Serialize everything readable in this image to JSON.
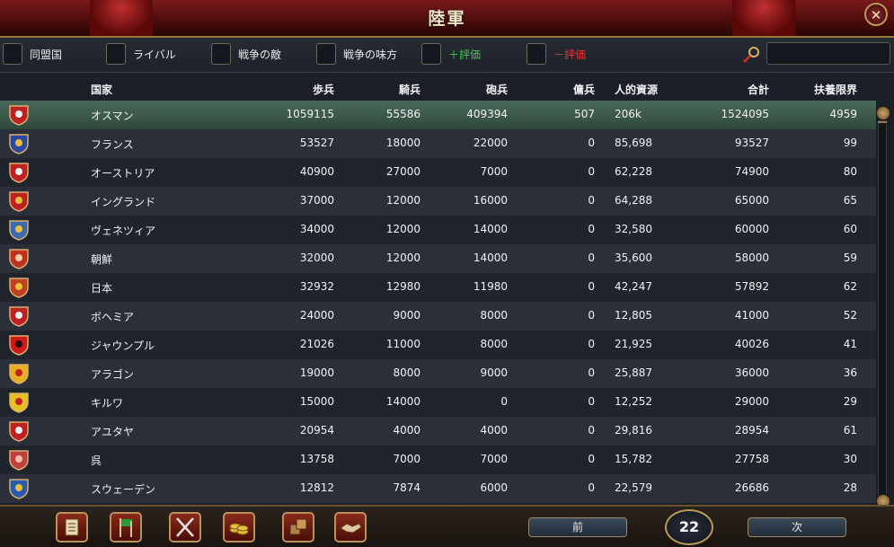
{
  "window": {
    "title": "陸軍",
    "close_label": "✕"
  },
  "filters": [
    {
      "label": "同盟国",
      "color": "#e8e8e8"
    },
    {
      "label": "ライバル",
      "color": "#e8e8e8"
    },
    {
      "label": "戦争の敵",
      "color": "#e8e8e8"
    },
    {
      "label": "戦争の味方",
      "color": "#e8e8e8"
    },
    {
      "label": "＋評価",
      "color": "#3ad04a"
    },
    {
      "label": "－評価",
      "color": "#e03a3a"
    }
  ],
  "search": {
    "value": ""
  },
  "columns": [
    "国家",
    "歩兵",
    "騎兵",
    "砲兵",
    "傭兵",
    "人的資源",
    "合計",
    "扶養限界"
  ],
  "rows": [
    {
      "country": "オスマン",
      "infantry": "1059115",
      "cavalry": "55586",
      "artillery": "409394",
      "mercenary": "507",
      "manpower": "206k",
      "total": "1524095",
      "force_limit": "4959",
      "shield_colors": [
        "#c02020",
        "#f0f0f0"
      ],
      "selected": true
    },
    {
      "country": "フランス",
      "infantry": "53527",
      "cavalry": "18000",
      "artillery": "22000",
      "mercenary": "0",
      "manpower": "85,698",
      "total": "93527",
      "force_limit": "99",
      "shield_colors": [
        "#2a4aa0",
        "#e8c040"
      ]
    },
    {
      "country": "オーストリア",
      "infantry": "40900",
      "cavalry": "27000",
      "artillery": "7000",
      "mercenary": "0",
      "manpower": "62,228",
      "total": "74900",
      "force_limit": "80",
      "shield_colors": [
        "#c02020",
        "#f0f0f0"
      ]
    },
    {
      "country": "イングランド",
      "infantry": "37000",
      "cavalry": "12000",
      "artillery": "16000",
      "mercenary": "0",
      "manpower": "64,288",
      "total": "65000",
      "force_limit": "65",
      "shield_colors": [
        "#c02020",
        "#e8c040"
      ]
    },
    {
      "country": "ヴェネツィア",
      "infantry": "34000",
      "cavalry": "12000",
      "artillery": "14000",
      "mercenary": "0",
      "manpower": "32,580",
      "total": "60000",
      "force_limit": "60",
      "shield_colors": [
        "#3a6ab0",
        "#e8c040"
      ]
    },
    {
      "country": "朝鮮",
      "infantry": "32000",
      "cavalry": "12000",
      "artillery": "14000",
      "mercenary": "0",
      "manpower": "35,600",
      "total": "58000",
      "force_limit": "59",
      "shield_colors": [
        "#c03020",
        "#f0d0a0"
      ]
    },
    {
      "country": "日本",
      "infantry": "32932",
      "cavalry": "12980",
      "artillery": "11980",
      "mercenary": "0",
      "manpower": "42,247",
      "total": "57892",
      "force_limit": "62",
      "shield_colors": [
        "#c04020",
        "#e8c040"
      ]
    },
    {
      "country": "ボヘミア",
      "infantry": "24000",
      "cavalry": "9000",
      "artillery": "8000",
      "mercenary": "0",
      "manpower": "12,805",
      "total": "41000",
      "force_limit": "52",
      "shield_colors": [
        "#c02020",
        "#f0f0f0"
      ]
    },
    {
      "country": "ジャウンプル",
      "infantry": "21026",
      "cavalry": "11000",
      "artillery": "8000",
      "mercenary": "0",
      "manpower": "21,925",
      "total": "40026",
      "force_limit": "41",
      "shield_colors": [
        "#d01a1a",
        "#2a0a0a"
      ]
    },
    {
      "country": "アラゴン",
      "infantry": "19000",
      "cavalry": "8000",
      "artillery": "9000",
      "mercenary": "0",
      "manpower": "25,887",
      "total": "36000",
      "force_limit": "36",
      "shield_colors": [
        "#e8b020",
        "#c02020"
      ]
    },
    {
      "country": "キルワ",
      "infantry": "15000",
      "cavalry": "14000",
      "artillery": "0",
      "mercenary": "0",
      "manpower": "12,252",
      "total": "29000",
      "force_limit": "29",
      "shield_colors": [
        "#e8c020",
        "#c02020"
      ]
    },
    {
      "country": "アユタヤ",
      "infantry": "20954",
      "cavalry": "4000",
      "artillery": "4000",
      "mercenary": "0",
      "manpower": "29,816",
      "total": "28954",
      "force_limit": "61",
      "shield_colors": [
        "#c02020",
        "#f0f0f0"
      ]
    },
    {
      "country": "呉",
      "infantry": "13758",
      "cavalry": "7000",
      "artillery": "7000",
      "mercenary": "0",
      "manpower": "15,782",
      "total": "27758",
      "force_limit": "30",
      "shield_colors": [
        "#c04040",
        "#f0c0a0"
      ]
    },
    {
      "country": "スウェーデン",
      "infantry": "12812",
      "cavalry": "7874",
      "artillery": "6000",
      "mercenary": "0",
      "manpower": "22,579",
      "total": "26686",
      "force_limit": "28",
      "shield_colors": [
        "#2a5ab0",
        "#e8c040"
      ]
    }
  ],
  "toolbar": {
    "buttons": [
      {
        "icon": "scroll-ledger-icon"
      },
      {
        "icon": "flags-icon"
      },
      {
        "icon": "crossed-swords-icon"
      },
      {
        "icon": "coins-icon"
      },
      {
        "icon": "crates-icon"
      },
      {
        "icon": "handshake-icon"
      }
    ]
  },
  "pagination": {
    "prev_label": "前",
    "page": "22",
    "next_label": "次"
  },
  "colors": {
    "accent_gold": "#b89a5a",
    "title_red": "#7a1a1a",
    "selected_row": "#3d5a4a"
  }
}
